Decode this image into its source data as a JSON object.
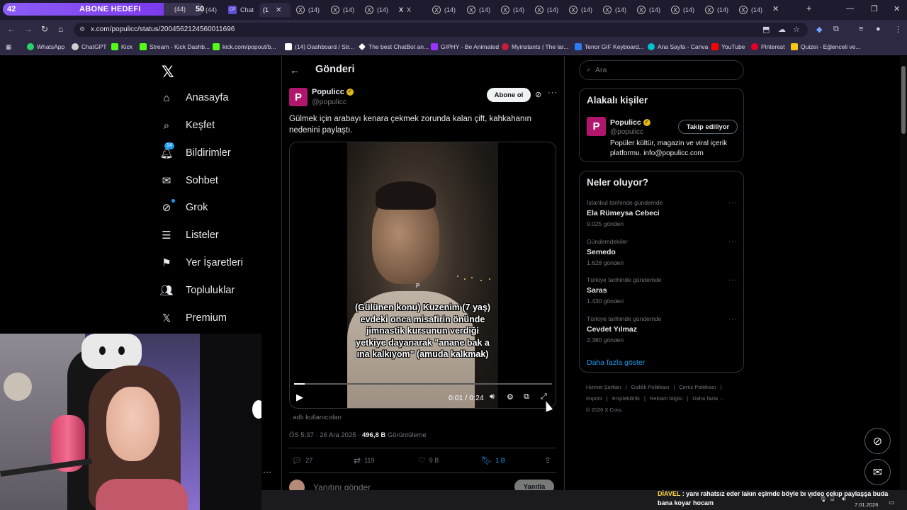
{
  "overlay": {
    "count": "42",
    "title": "ABONE HEDEFI",
    "current": "(44)",
    "target": "50"
  },
  "tabs": [
    {
      "label": "(44)"
    },
    {
      "label": "Chat"
    },
    {
      "label": "(1"
    },
    {
      "label": "(14)"
    },
    {
      "label": "(14)"
    },
    {
      "label": "(14)"
    },
    {
      "label": "X"
    },
    {
      "label": "(14)"
    },
    {
      "label": "(14)"
    },
    {
      "label": "(14)"
    },
    {
      "label": "(14)"
    },
    {
      "label": "(14)"
    },
    {
      "label": "(14)"
    },
    {
      "label": "(14)"
    },
    {
      "label": "(14)"
    },
    {
      "label": "(14)"
    },
    {
      "label": "(14)"
    }
  ],
  "browser": {
    "url": "x.com/populicc/status/2004562124560011696"
  },
  "bookmarks": [
    {
      "label": "WhatsApp",
      "color": "#25d366"
    },
    {
      "label": "ChatGPT",
      "color": "#cfcfcf"
    },
    {
      "label": "Kick",
      "color": "#53fc18"
    },
    {
      "label": "Stream - Kick Dashb...",
      "color": "#53fc18"
    },
    {
      "label": "kick.com/popout/b...",
      "color": "#53fc18"
    },
    {
      "label": "(14) Dashboard / Str...",
      "color": "#ffffff"
    },
    {
      "label": "The best ChatBot an...",
      "color": "#ffffff"
    },
    {
      "label": "GIPHY - Be Animated",
      "color": "#9933ff"
    },
    {
      "label": "Myinstants | The lar...",
      "color": "#c41e3a"
    },
    {
      "label": "Tenor GIF Keyboard...",
      "color": "#2e7bf6"
    },
    {
      "label": "Ana Sayfa - Canva",
      "color": "#00c4cc"
    },
    {
      "label": "YouTube",
      "color": "#ff0000"
    },
    {
      "label": "Pinterest",
      "color": "#e60023"
    },
    {
      "label": "Quizei - Eğlenceli ve...",
      "color": "#f5c518"
    }
  ],
  "nav": {
    "items": [
      {
        "label": "Anasayfa",
        "icon": "home-icon"
      },
      {
        "label": "Keşfet",
        "icon": "search-icon"
      },
      {
        "label": "Bildirimler",
        "icon": "bell-icon",
        "badge": "14"
      },
      {
        "label": "Sohbet",
        "icon": "mail-icon"
      },
      {
        "label": "Grok",
        "icon": "grok-icon"
      },
      {
        "label": "Listeler",
        "icon": "list-icon"
      },
      {
        "label": "Yer İşaretleri",
        "icon": "bookmark-icon"
      },
      {
        "label": "Topluluklar",
        "icon": "people-icon"
      },
      {
        "label": "Premium",
        "icon": "x-icon"
      }
    ]
  },
  "post": {
    "header_title": "Gönderi",
    "author_name": "Populicc",
    "author_handle": "@populicc",
    "follow_label": "Abone ol",
    "text": "Gülmek için arabayı kenara çekmek zorunda kalan çift, kahkahanın nedenini paylaştı.",
    "video": {
      "caption": "(Gülünen konu) Kuzenim (7 yaş) evdeki onca misafirin önünde jimnastik kursunun verdiği yetkiye dayanarak \"anane bak a    ına kalkıyom\" (amuda kalkmak)",
      "time": "0:01 / 0:24",
      "progress": 0.04
    },
    "from_user": ". adlı kullanıcıdan",
    "timestamp": "ÖS 5:37 · 26 Ara 2025 · ",
    "views_count": "496,8 B",
    "views_label": " Görüntüleme",
    "actions": {
      "replies": "27",
      "reposts": "119",
      "likes": "9 B",
      "bookmarks": "1 B"
    },
    "reply_placeholder": "Yanıtını gönder",
    "reply_button": "Yanıtla"
  },
  "search": {
    "placeholder": "Ara"
  },
  "related": {
    "title": "Alakalı kişiler",
    "name": "Populicc",
    "handle": "@populicc",
    "following_label": "Takip ediliyor",
    "bio": "Popüler kültür, magazin ve viral içerik platformu. info@populicc.com"
  },
  "trends": {
    "title": "Neler oluyor?",
    "items": [
      {
        "context": "İstanbul tarihinde gündemde",
        "name": "Ela Rümeysa Cebeci",
        "count": "9.025 gönderi"
      },
      {
        "context": "Gündemdekiler",
        "name": "Semedo",
        "count": "1.628 gönderi"
      },
      {
        "context": "Türkiye tarihinde gündemde",
        "name": "Saras",
        "count": "1.430 gönderi"
      },
      {
        "context": "Türkiye tarihinde gündemde",
        "name": "Cevdet Yılmaz",
        "count": "2.380 gönderi"
      }
    ],
    "show_more": "Daha fazla göster"
  },
  "footer": {
    "links": [
      "Hizmet Şartları",
      "|",
      "Gizlilik Politikası",
      "|",
      "Çerez Politikası",
      "|",
      "Imprint",
      "|",
      "Erişilebilirlik",
      "|",
      "Reklam bilgisi",
      "|",
      "Daha fazla ···"
    ],
    "copyright": "© 2026 X Corp."
  },
  "chat": {
    "user": "DİAVEL",
    "message": " : yanı rahatsız eder lakın eşimde böyle bı vıdeo çekıp paylaşşa buda bana koyar hocam"
  },
  "taskbar": {
    "date": "7.01.2026"
  }
}
